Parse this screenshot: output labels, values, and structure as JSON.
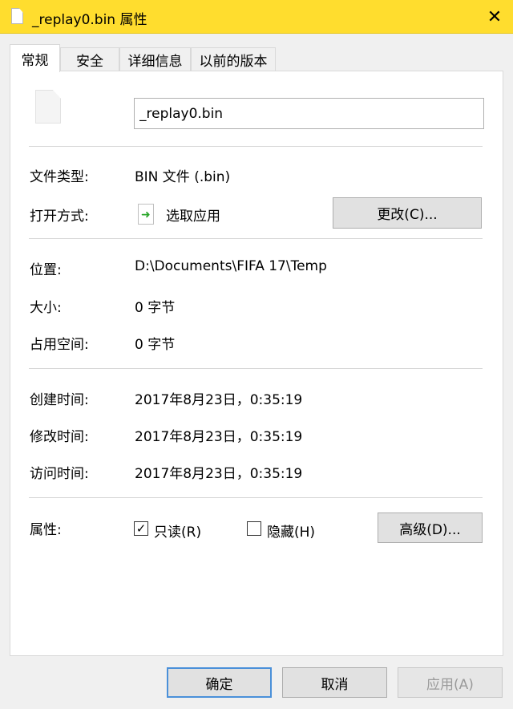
{
  "window": {
    "title": "_replay0.bin 属性",
    "close_glyph": "✕"
  },
  "tabs": [
    {
      "label": "常规",
      "active": true
    },
    {
      "label": "安全",
      "active": false
    },
    {
      "label": "详细信息",
      "active": false
    },
    {
      "label": "以前的版本",
      "active": false
    }
  ],
  "general": {
    "file_name": "_replay0.bin",
    "type_label": "文件类型:",
    "type_value": "BIN 文件 (.bin)",
    "opens_with_label": "打开方式:",
    "opens_with_value": "选取应用",
    "change_button": "更改(C)...",
    "location_label": "位置:",
    "location_value": "D:\\Documents\\FIFA 17\\Temp",
    "size_label": "大小:",
    "size_value": "0 字节",
    "size_on_disk_label": "占用空间:",
    "size_on_disk_value": "0 字节",
    "created_label": "创建时间:",
    "created_value": "2017年8月23日，0:35:19",
    "modified_label": "修改时间:",
    "modified_value": "2017年8月23日，0:35:19",
    "accessed_label": "访问时间:",
    "accessed_value": "2017年8月23日，0:35:19",
    "attributes_label": "属性:",
    "readonly_label": "只读(R)",
    "readonly_checked": true,
    "hidden_label": "隐藏(H)",
    "hidden_checked": false,
    "advanced_button": "高级(D)..."
  },
  "footer": {
    "ok": "确定",
    "cancel": "取消",
    "apply": "应用(A)"
  },
  "icons": {
    "file": "file-icon",
    "app": "open-with-app-icon",
    "check": "✓"
  },
  "colors": {
    "titlebar": "#ffdd2e",
    "default_button_border": "#4a90d9"
  }
}
